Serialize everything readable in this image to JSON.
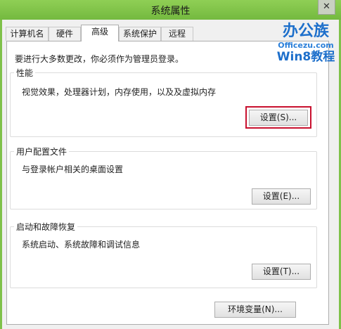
{
  "window": {
    "title": "系统属性",
    "close_glyph": "✕"
  },
  "tabs": [
    {
      "label": "计算机名",
      "active": false
    },
    {
      "label": "硬件",
      "active": false
    },
    {
      "label": "高级",
      "active": true
    },
    {
      "label": "系统保护",
      "active": false
    },
    {
      "label": "远程",
      "active": false
    }
  ],
  "intro_text": "要进行大多数更改，你必须作为管理员登录。",
  "groups": {
    "performance": {
      "title": "性能",
      "description": "视觉效果，处理器计划，内存使用，以及及虚拟内存",
      "button_label": "设置(S)..."
    },
    "user_profiles": {
      "title": "用户配置文件",
      "description": "与登录帐户相关的桌面设置",
      "button_label": "设置(E)..."
    },
    "startup_recovery": {
      "title": "启动和故障恢复",
      "description": "系统启动、系统故障和调试信息",
      "button_label": "设置(T)..."
    }
  },
  "env_button_label": "环境变量(N)...",
  "watermark": {
    "line1": "办公族",
    "line2": "Officezu.com",
    "line3": "Win8教程"
  },
  "colors": {
    "window_frame": "#7fc14a",
    "highlight": "#c8102e",
    "watermark_blue": "#1d6fcb"
  }
}
